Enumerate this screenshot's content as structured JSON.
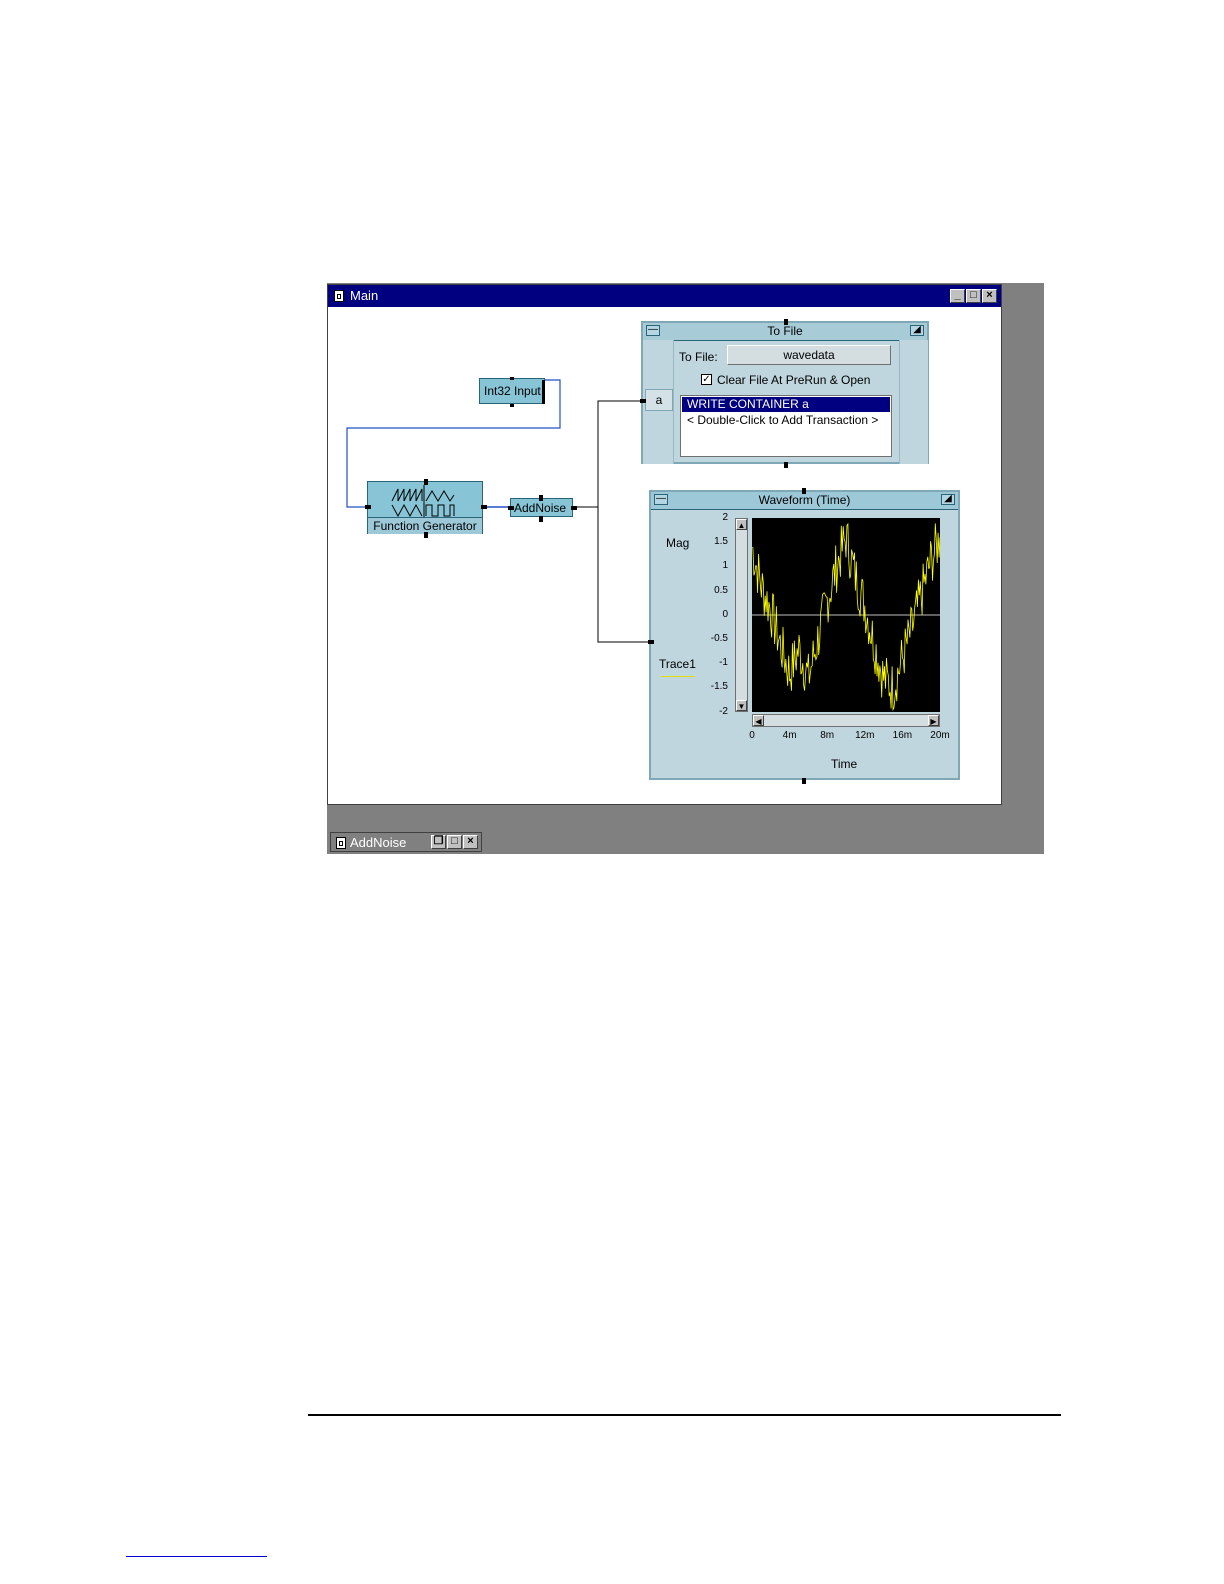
{
  "main_window": {
    "title": "Main",
    "buttons": {
      "minimize": "_",
      "maximize": "□",
      "close": "×"
    }
  },
  "objects": {
    "int32_input": {
      "label": "Int32 Input"
    },
    "function_generator": {
      "label": "Function Generator"
    },
    "add_noise": {
      "label": "AddNoise"
    }
  },
  "to_file": {
    "title": "To File",
    "file_label": "To File:",
    "file_name": "wavedata",
    "checkbox_checked": true,
    "checkbox_mark": "✓",
    "checkbox_label": "Clear File At PreRun & Open",
    "input_pin": "a",
    "transactions": [
      "WRITE CONTAINER a",
      "< Double-Click to Add Transaction >"
    ]
  },
  "waveform": {
    "title": "Waveform (Time)",
    "ylabel": "Mag",
    "xlabel": "Time",
    "trace_name": "Trace1",
    "trace_color": "#ffff00",
    "y_ticks": [
      "2",
      "1.5",
      "1",
      "0.5",
      "0",
      "-0.5",
      "-1",
      "-1.5",
      "-2"
    ],
    "x_ticks": [
      "0",
      "4m",
      "8m",
      "12m",
      "16m",
      "20m"
    ]
  },
  "minimized_window": {
    "title": "AddNoise"
  },
  "chart_data": {
    "type": "line",
    "title": "Waveform (Time)",
    "xlabel": "Time",
    "ylabel": "Mag",
    "xlim": [
      0,
      0.02
    ],
    "ylim": [
      -2,
      2
    ],
    "grid": false,
    "series": [
      {
        "name": "Trace1",
        "color": "#ffff00",
        "description_values": [
          {
            "x": 0.0,
            "y": 1.4
          },
          {
            "x": 0.001,
            "y": 0.6
          },
          {
            "x": 0.002,
            "y": 0.1
          },
          {
            "x": 0.003,
            "y": -0.6
          },
          {
            "x": 0.004,
            "y": -1.2
          },
          {
            "x": 0.005,
            "y": -0.7
          },
          {
            "x": 0.006,
            "y": -1.3
          },
          {
            "x": 0.007,
            "y": -0.5
          },
          {
            "x": 0.008,
            "y": 0.3
          },
          {
            "x": 0.009,
            "y": 1.0
          },
          {
            "x": 0.01,
            "y": 1.6
          },
          {
            "x": 0.011,
            "y": 0.8
          },
          {
            "x": 0.012,
            "y": 0.2
          },
          {
            "x": 0.013,
            "y": -0.6
          },
          {
            "x": 0.014,
            "y": -1.3
          },
          {
            "x": 0.015,
            "y": -1.5
          },
          {
            "x": 0.016,
            "y": -0.9
          },
          {
            "x": 0.017,
            "y": -0.3
          },
          {
            "x": 0.018,
            "y": 0.4
          },
          {
            "x": 0.019,
            "y": 1.1
          },
          {
            "x": 0.02,
            "y": 1.6
          }
        ]
      }
    ]
  }
}
